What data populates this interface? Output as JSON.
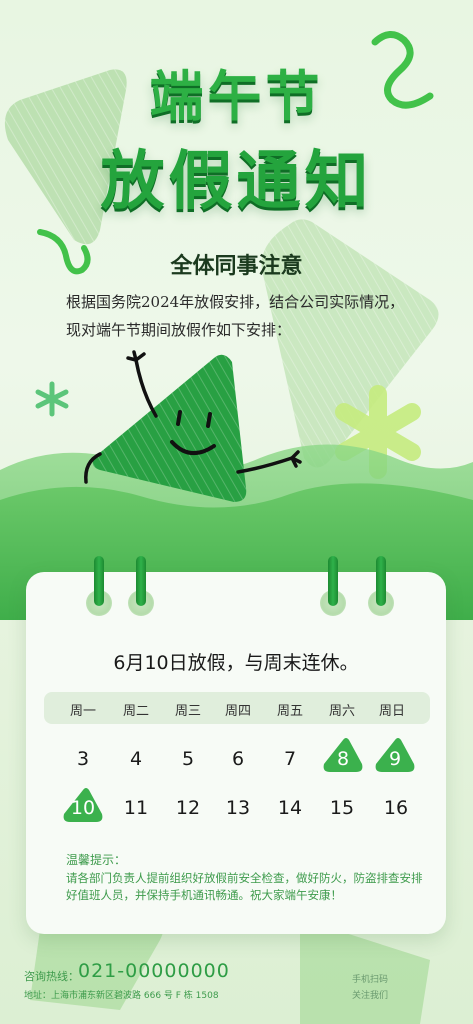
{
  "title_line1": "端午节",
  "title_line2": "放假通知",
  "heading": "全体同事注意",
  "intro": "根据国务院2024年放假安排，结合公司实际情况，现对端午节期间放假作如下安排：",
  "calendar": {
    "headline": "6月10日放假，与周末连休。",
    "weekdays": [
      "周一",
      "周二",
      "周三",
      "周四",
      "周五",
      "周六",
      "周日"
    ],
    "week1": [
      "3",
      "4",
      "5",
      "6",
      "7",
      "8",
      "9"
    ],
    "week2": [
      "10",
      "11",
      "12",
      "13",
      "14",
      "15",
      "16"
    ],
    "holiday_days": [
      "8",
      "9",
      "10"
    ]
  },
  "tips": {
    "title": "温馨提示：",
    "text": "请各部门负责人提前组织好放假前安全检查，做好防火，防盗排查安排好值班人员，并保持手机通讯畅通。祝大家端午安康！"
  },
  "footer": {
    "hotline_label": "咨询热线：",
    "hotline_number": "021-00000000",
    "address": "地址：上海市浦东新区碧波路 666 号 F 栋 1508",
    "qr_line1": "手机扫码",
    "qr_line2": "关注我们"
  },
  "colors": {
    "accent": "#2db044",
    "dark_green": "#1c8a31",
    "text_green": "#3e9b4c"
  }
}
